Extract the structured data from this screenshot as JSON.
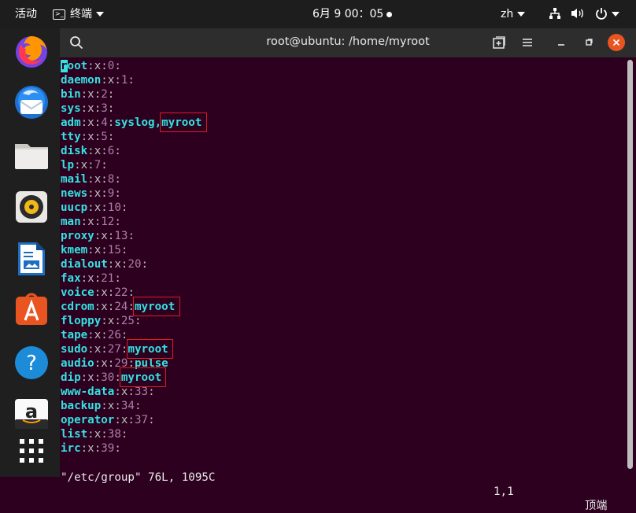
{
  "topbar": {
    "activities": "活动",
    "app_label": "终端",
    "clock": "6月 9 00：05",
    "lang": "zh"
  },
  "window": {
    "title": "root@ubuntu: /home/myroot"
  },
  "dock": {
    "items": [
      "firefox-icon",
      "thunderbird-icon",
      "files-icon",
      "rhythmbox-icon",
      "libreoffice-writer-icon",
      "software-center-icon",
      "help-icon",
      "amazon-icon",
      "show-apps-icon"
    ]
  },
  "terminal": {
    "lines": [
      {
        "name": "root",
        "gid": "0",
        "members": ""
      },
      {
        "name": "daemon",
        "gid": "1",
        "members": ""
      },
      {
        "name": "bin",
        "gid": "2",
        "members": ""
      },
      {
        "name": "sys",
        "gid": "3",
        "members": ""
      },
      {
        "name": "adm",
        "gid": "4",
        "members": "syslog,myroot"
      },
      {
        "name": "tty",
        "gid": "5",
        "members": ""
      },
      {
        "name": "disk",
        "gid": "6",
        "members": ""
      },
      {
        "name": "lp",
        "gid": "7",
        "members": ""
      },
      {
        "name": "mail",
        "gid": "8",
        "members": ""
      },
      {
        "name": "news",
        "gid": "9",
        "members": ""
      },
      {
        "name": "uucp",
        "gid": "10",
        "members": ""
      },
      {
        "name": "man",
        "gid": "12",
        "members": ""
      },
      {
        "name": "proxy",
        "gid": "13",
        "members": ""
      },
      {
        "name": "kmem",
        "gid": "15",
        "members": ""
      },
      {
        "name": "dialout",
        "gid": "20",
        "members": ""
      },
      {
        "name": "fax",
        "gid": "21",
        "members": ""
      },
      {
        "name": "voice",
        "gid": "22",
        "members": ""
      },
      {
        "name": "cdrom",
        "gid": "24",
        "members": "myroot"
      },
      {
        "name": "floppy",
        "gid": "25",
        "members": ""
      },
      {
        "name": "tape",
        "gid": "26",
        "members": ""
      },
      {
        "name": "sudo",
        "gid": "27",
        "members": "myroot"
      },
      {
        "name": "audio",
        "gid": "29",
        "members": "pulse"
      },
      {
        "name": "dip",
        "gid": "30",
        "members": "myroot"
      },
      {
        "name": "www-data",
        "gid": "33",
        "members": ""
      },
      {
        "name": "backup",
        "gid": "34",
        "members": ""
      },
      {
        "name": "operator",
        "gid": "37",
        "members": ""
      },
      {
        "name": "list",
        "gid": "38",
        "members": ""
      },
      {
        "name": "irc",
        "gid": "39",
        "members": ""
      }
    ],
    "highlighted_members": [
      "adm",
      "cdrom",
      "sudo",
      "dip"
    ],
    "status_file": "\"/etc/group\" 76L, 1095C",
    "status_pos": "1,1",
    "status_scroll": "顶端"
  },
  "colors": {
    "terminal_bg": "#2c001e",
    "group_name": "#34e2e2",
    "gid": "#ad7fa8",
    "highlight_box": "#e01b24"
  }
}
